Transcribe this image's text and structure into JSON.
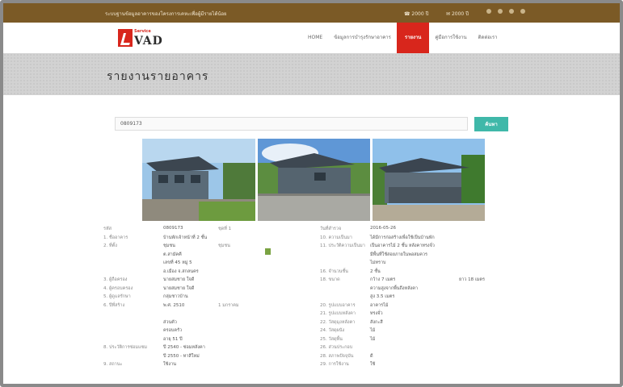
{
  "topbar": {
    "announce": "ระบบฐานข้อมูลอาคารของโครงการเคหะเพื่อผู้มีรายได้น้อย",
    "phone": "2000 ปี",
    "email": "2000 ปี"
  },
  "navbar": {
    "logo_top": "Service",
    "logo_word": "VAD",
    "menu": [
      "HOME",
      "ข้อมูลการบำรุงรักษาอาคาร",
      "รายงาน",
      "คู่มือการใช้งาน",
      "ติดต่อเรา"
    ],
    "active_index": 2
  },
  "hero": {
    "title": "รายงานรายอาคาร"
  },
  "search": {
    "value": "0809173",
    "button": "ค้นหา"
  },
  "details": {
    "rows": [
      {
        "label": "รหัส",
        "value": "0809173",
        "label2": "ชุดที่ 1",
        "label3": "วันที่สำรวจ",
        "value3": "2016-05-26"
      },
      {
        "label": "1. ชื่ออาคาร",
        "value": "บ้านพักเจ้าหน้าที่ 2 ชั้น",
        "label2": "",
        "label3": "10. ความเป็นมา",
        "value3": "ได้มีการก่อสร้างเพื่อใช้เป็นบ้านพัก"
      },
      {
        "label": "2. ที่ตั้ง",
        "value": "ชุมชน",
        "label2": "ชุมชน",
        "label3": "11. ประวัติความเป็นมา",
        "value3": "เป็นอาคารไม้ 2 ชั้น หลังคาทรงจั่ว"
      },
      {
        "label": "",
        "value": "ต.สามัคคี",
        "label2": "",
        "label3": "",
        "value3": "มีพื้นที่ใช้สอยภายในพอสมควร"
      },
      {
        "label": "",
        "value": "เลขที่ 45 หมู่ 5",
        "label2": "",
        "label3": "",
        "value3": "ไม่ทราบ"
      },
      {
        "label": "",
        "value": "อ.เมือง จ.สกลนคร",
        "label2": "",
        "label3": "16. จำนวนชั้น",
        "value3": "2 ชั้น"
      },
      {
        "label": "3. ผู้ถือครอง",
        "value": "นายสมชาย ใจดี",
        "label2": "",
        "label3": "18. ขนาด",
        "value3": "กว้าง 7 เมตร",
        "value4": "ยาว 18 เมตร"
      },
      {
        "label": "4. ผู้ครอบครอง",
        "value": "นายสมชาย ใจดี",
        "label2": "",
        "label3": "",
        "value3": "ความสูงจากพื้นถึงหลังคา"
      },
      {
        "label": "5. ผู้ดูแลรักษา",
        "value": "กลุ่มชาวบ้าน",
        "label2": "",
        "label3": "",
        "value3": "สูง 3.5 เมตร"
      },
      {
        "label": "6. ปีที่สร้าง",
        "value": "พ.ศ. 2510",
        "label2": "1 มกราคม",
        "label3": "20. รูปแบบอาคาร",
        "value3": "อาคารไม้"
      },
      {
        "label": "",
        "value": "",
        "label2": "",
        "label3": "21. รูปแบบหลังคา",
        "value3": "ทรงจั่ว"
      },
      {
        "label": "",
        "value": "ส่วนตัว",
        "label2": "",
        "label3": "22. วัสดุมุงหลังคา",
        "value3": "สังกะสี"
      },
      {
        "label": "",
        "value": "ครอบครัว",
        "label2": "",
        "label3": "24. วัสดุผนัง",
        "value3": "ไม้"
      },
      {
        "label": "",
        "value": "อายุ 51 ปี",
        "label2": "",
        "label3": "25. วัสดุพื้น",
        "value3": "ไม้"
      },
      {
        "label": "8. ประวัติการซ่อมแซม",
        "value": "ปี 2540 - ซ่อมหลังคา",
        "label2": "",
        "label3": "26. ส่วนประกอบ",
        "value3": ""
      },
      {
        "label": "",
        "value": "ปี 2550 - ทาสีใหม่",
        "label2": "",
        "label3": "28. สภาพปัจจุบัน",
        "value3": "ดี"
      },
      {
        "label": "9. สถานะ",
        "value": "ใช้งาน",
        "label2": "",
        "label3": "29. การใช้งาน",
        "value3": "ใช้"
      }
    ]
  }
}
